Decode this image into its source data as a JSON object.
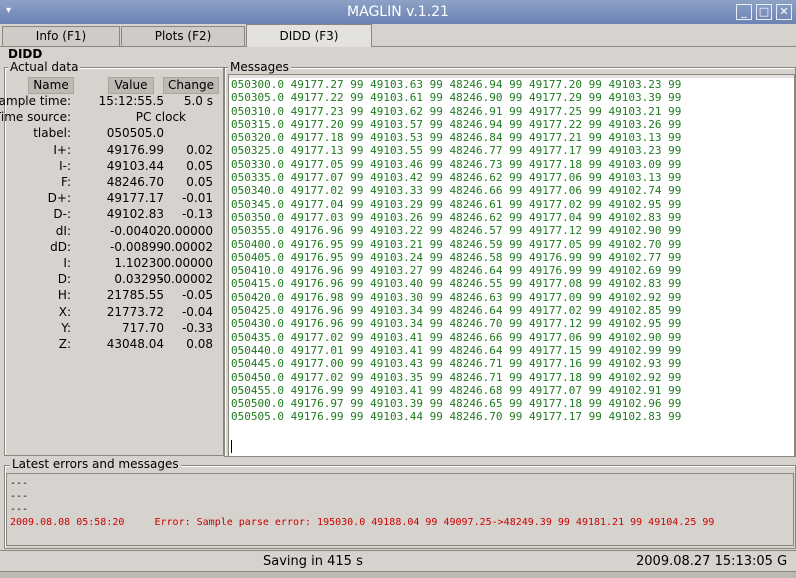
{
  "window": {
    "title": "MAGLIN v.1.21",
    "menu_glyph": "▾",
    "minimize_glyph": "_",
    "maximize_glyph": "□",
    "close_glyph": "✕"
  },
  "tabs": [
    {
      "label": "Info (F1)",
      "active": false
    },
    {
      "label": "Plots (F2)",
      "active": false
    },
    {
      "label": "DIDD (F3)",
      "active": true
    }
  ],
  "section_title": "DIDD",
  "actual_data": {
    "title": "Actual data",
    "headers": {
      "name": "Name",
      "value": "Value",
      "change": "Change"
    },
    "rows": [
      {
        "label": "Sample time:",
        "value": "15:12:55.5",
        "change": "5.0 s"
      },
      {
        "label": "Time source:",
        "value": "PC clock",
        "change": ""
      },
      {
        "label": "tlabel:",
        "value": "050505.0",
        "change": ""
      },
      {
        "label": "I+:",
        "value": "49176.99",
        "change": "0.02"
      },
      {
        "label": "I-:",
        "value": "49103.44",
        "change": "0.05"
      },
      {
        "label": "F:",
        "value": "48246.70",
        "change": "0.05"
      },
      {
        "label": "D+:",
        "value": "49177.17",
        "change": "-0.01"
      },
      {
        "label": "D-:",
        "value": "49102.83",
        "change": "-0.13"
      },
      {
        "label": "dI:",
        "value": "-0.00402",
        "change": "0.00000"
      },
      {
        "label": "dD:",
        "value": "-0.00899",
        "change": "-0.00002"
      },
      {
        "label": "I:",
        "value": "1.10230",
        "change": "0.00000"
      },
      {
        "label": "D:",
        "value": "0.03295",
        "change": "-0.00002"
      },
      {
        "label": "H:",
        "value": "21785.55",
        "change": "-0.05"
      },
      {
        "label": "X:",
        "value": "21773.72",
        "change": "-0.04"
      },
      {
        "label": "Y:",
        "value": "717.70",
        "change": "-0.33"
      },
      {
        "label": "Z:",
        "value": "43048.04",
        "change": "0.08"
      }
    ]
  },
  "messages": {
    "title": "Messages",
    "lines": [
      "050300.0 49177.27 99 49103.63 99 48246.94 99 49177.20 99 49103.23 99",
      "050305.0 49177.22 99 49103.61 99 48246.90 99 49177.29 99 49103.39 99",
      "050310.0 49177.23 99 49103.62 99 48246.91 99 49177.25 99 49103.21 99",
      "050315.0 49177.20 99 49103.57 99 48246.94 99 49177.22 99 49103.26 99",
      "050320.0 49177.18 99 49103.53 99 48246.84 99 49177.21 99 49103.13 99",
      "050325.0 49177.13 99 49103.55 99 48246.77 99 49177.17 99 49103.23 99",
      "050330.0 49177.05 99 49103.46 99 48246.73 99 49177.18 99 49103.09 99",
      "050335.0 49177.07 99 49103.42 99 48246.62 99 49177.06 99 49103.13 99",
      "050340.0 49177.02 99 49103.33 99 48246.66 99 49177.06 99 49102.74 99",
      "050345.0 49177.04 99 49103.29 99 48246.61 99 49177.02 99 49102.95 99",
      "050350.0 49177.03 99 49103.26 99 48246.62 99 49177.04 99 49102.83 99",
      "050355.0 49176.96 99 49103.22 99 48246.57 99 49177.12 99 49102.90 99",
      "050400.0 49176.95 99 49103.21 99 48246.59 99 49177.05 99 49102.70 99",
      "050405.0 49176.95 99 49103.24 99 48246.58 99 49176.99 99 49102.77 99",
      "050410.0 49176.96 99 49103.27 99 48246.64 99 49176.99 99 49102.69 99",
      "050415.0 49176.96 99 49103.40 99 48246.55 99 49177.08 99 49102.83 99",
      "050420.0 49176.98 99 49103.30 99 48246.63 99 49177.09 99 49102.92 99",
      "050425.0 49176.96 99 49103.34 99 48246.64 99 49177.02 99 49102.85 99",
      "050430.0 49176.96 99 49103.34 99 48246.70 99 49177.12 99 49102.95 99",
      "050435.0 49177.02 99 49103.41 99 48246.66 99 49177.06 99 49102.90 99",
      "050440.0 49177.01 99 49103.41 99 48246.64 99 49177.15 99 49102.99 99",
      "050445.0 49177.00 99 49103.43 99 48246.71 99 49177.16 99 49102.93 99",
      "050450.0 49177.02 99 49103.35 99 48246.71 99 49177.18 99 49102.92 99",
      "050455.0 49176.99 99 49103.41 99 48246.68 99 49177.07 99 49102.91 99",
      "050500.0 49176.97 99 49103.39 99 48246.65 99 49177.18 99 49102.96 99",
      "050505.0 49176.99 99 49103.44 99 48246.70 99 49177.17 99 49102.83 99"
    ],
    "text_color": "#1f7a1f"
  },
  "errors": {
    "title": "Latest errors and messages",
    "lines": [
      {
        "text": "---",
        "color": "#000000"
      },
      {
        "text": "---",
        "color": "#000000"
      },
      {
        "text": "---",
        "color": "#000000"
      },
      {
        "text": "2009.08.08 05:58:20     Error: Sample parse error: 195030.0 49188.04 99 49097.25->48249.39 99 49181.21 99 49104.25 99",
        "color": "#cc0000"
      }
    ]
  },
  "status": {
    "saving": "Saving in 415 s",
    "datetime": "2009.08.27 15:13:05 G"
  }
}
